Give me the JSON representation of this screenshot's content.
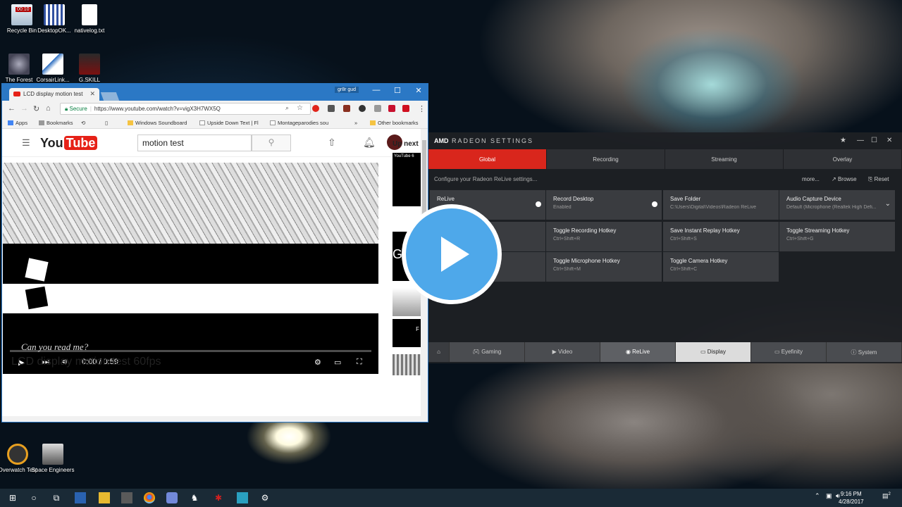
{
  "desktop": {
    "icons": [
      {
        "label": "Recycle Bin",
        "name": "recycle-bin-icon",
        "color": "#d8e6f2"
      },
      {
        "label": "DesktopOK...",
        "name": "desktopok-icon",
        "color": "#e8e8f8"
      },
      {
        "label": "nativelog.txt",
        "name": "text-file-icon",
        "color": "#ffffff"
      },
      {
        "label": "The Forest",
        "name": "the-forest-icon",
        "color": "#5a6a50"
      },
      {
        "label": "CorsairLink...",
        "name": "corsairlink-icon",
        "color": "#f5f5f5"
      },
      {
        "label": "G.SKILL",
        "name": "gskill-icon",
        "color": "#7a1010"
      },
      {
        "label": "Overwatch Test",
        "name": "overwatch-icon",
        "color": "#e8a020"
      },
      {
        "label": "Space Engineers",
        "name": "space-engineers-icon",
        "color": "#c8c8c8"
      }
    ],
    "recording_time": "00:10"
  },
  "chrome": {
    "tab_title": "LCD display motion test",
    "profile": "gr8r gud",
    "secure_label": "Secure",
    "url": "https://www.youtube.com/watch?v=vigX3H7WX5Q",
    "bookmarks": [
      "Apps",
      "Bookmarks",
      "Windows Soundboard",
      "Upside Down Text | Fl",
      "Montageparodies sou",
      "Other bookmarks"
    ]
  },
  "youtube": {
    "logo": "You",
    "logo_tube": "Tube",
    "search_value": "motion test",
    "caption": "Can you read me?",
    "time": "0:00 / 0:59",
    "video_title": "LCD display motion test 60fps",
    "up_next": "Up next",
    "thumb1_title": "YouTube 6",
    "thumb2_text": "GR",
    "thumb3_text": "F",
    "progress": 0
  },
  "radeon": {
    "brand": "AMD",
    "title": "RADEON SETTINGS",
    "tabs": [
      "Global",
      "Recording",
      "Streaming",
      "Overlay"
    ],
    "subtitle": "Configure your Radeon ReLive settings...",
    "actions": {
      "more": "more...",
      "browse": "Browse",
      "reset": "Reset"
    },
    "cells": [
      {
        "title": "ReLive",
        "value": ""
      },
      {
        "title": "Record Desktop",
        "value": "Enabled"
      },
      {
        "title": "Save Folder",
        "value": "C:\\Users\\Digital\\Videos\\Radeon ReLive"
      },
      {
        "title": "Audio Capture Device",
        "value": "Default (Microphone (Realtek High Defi..."
      },
      {
        "title": "Toggle Recording Hotkey",
        "value": "Ctrl+Shift+R"
      },
      {
        "title": "Save Instant Replay Hotkey",
        "value": "Ctrl+Shift+S"
      },
      {
        "title": "Toggle Streaming Hotkey",
        "value": "Ctrl+Shift+G"
      },
      {
        "title": "Toggle Microphone Hotkey",
        "value": "Ctrl+Shift+M"
      },
      {
        "title": "Toggle Camera Hotkey",
        "value": "Ctrl+Shift+C"
      }
    ],
    "bottom": [
      "Gaming",
      "Video",
      "ReLive",
      "Display",
      "Eyefinity",
      "System"
    ],
    "accent": "#d9261c"
  },
  "taskbar": {
    "time": "9:16 PM",
    "date": "4/28/2017",
    "notif_count": "2"
  }
}
